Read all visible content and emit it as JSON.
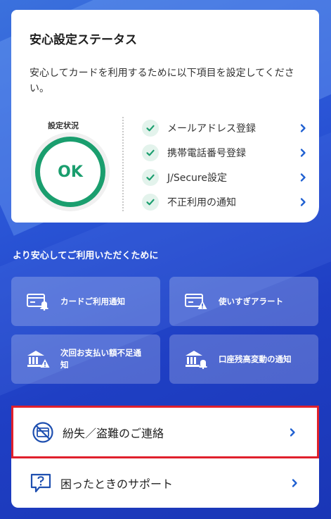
{
  "status_card": {
    "title": "安心設定ステータス",
    "description": "安心してカードを利用するために以下項目を設定してください。",
    "gauge_label": "設定状況",
    "gauge_value": "OK",
    "items": [
      {
        "label": "メールアドレス登録",
        "icon": "check-icon"
      },
      {
        "label": "携帯電話番号登録",
        "icon": "check-icon"
      },
      {
        "label": "J/Secure設定",
        "icon": "check-icon"
      },
      {
        "label": "不正利用の通知",
        "icon": "check-icon"
      }
    ]
  },
  "section_heading": "より安心してご利用いただくために",
  "tiles": [
    {
      "label": "カードご利用通知",
      "icon": "card-bell-icon"
    },
    {
      "label": "使いすぎアラート",
      "icon": "card-warning-icon"
    },
    {
      "label": "次回お支払い額不足通知",
      "icon": "bank-warning-icon"
    },
    {
      "label": "口座残高変動の通知",
      "icon": "bank-bell-icon"
    }
  ],
  "panels": {
    "lost": {
      "label": "紛失／盗難のご連絡",
      "icon": "card-prohibited-icon"
    },
    "support": {
      "label": "困ったときのサポート",
      "icon": "question-bubble-icon"
    }
  },
  "colors": {
    "accent_green": "#1a9e6e",
    "chevron_blue": "#1e5fd1",
    "highlight_red": "#e0202c",
    "background_blue": "#2a55d6"
  }
}
